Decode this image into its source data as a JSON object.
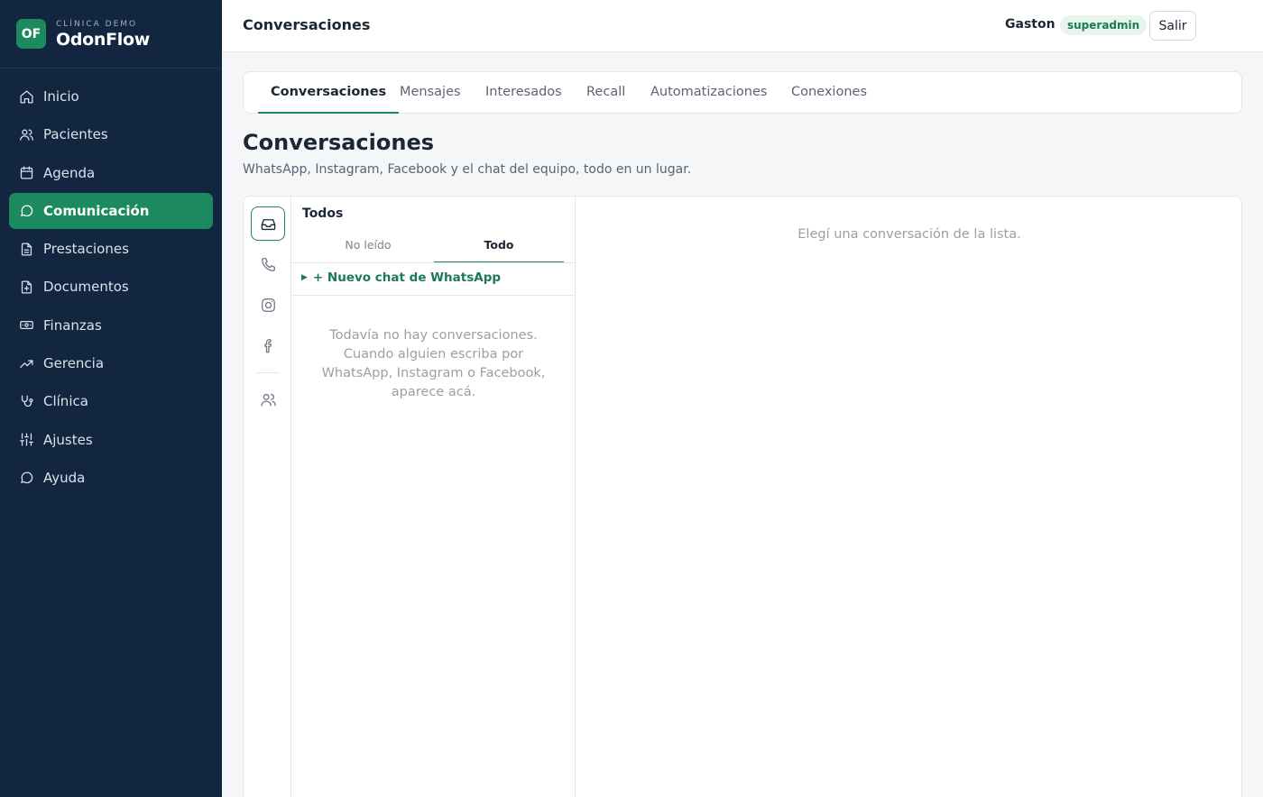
{
  "brand": {
    "logo_text": "OF",
    "subtitle": "CLÍNICA DEMO",
    "name": "OdonFlow"
  },
  "sidebar": {
    "items": [
      {
        "label": "Inicio",
        "icon": "home-icon",
        "active": false
      },
      {
        "label": "Pacientes",
        "icon": "users-icon",
        "active": false
      },
      {
        "label": "Agenda",
        "icon": "calendar-icon",
        "active": false
      },
      {
        "label": "Comunicación",
        "icon": "chat-bubble-icon",
        "active": true
      },
      {
        "label": "Prestaciones",
        "icon": "document-list-icon",
        "active": false
      },
      {
        "label": "Documentos",
        "icon": "document-plus-icon",
        "active": false
      },
      {
        "label": "Finanzas",
        "icon": "banknote-icon",
        "active": false
      },
      {
        "label": "Gerencia",
        "icon": "trending-up-icon",
        "active": false
      },
      {
        "label": "Clínica",
        "icon": "stethoscope-icon",
        "active": false
      },
      {
        "label": "Ajustes",
        "icon": "sliders-icon",
        "active": false
      },
      {
        "label": "Ayuda",
        "icon": "help-bubble-icon",
        "active": false
      }
    ]
  },
  "header": {
    "title": "Conversaciones",
    "user_name": "Gaston",
    "role": "superadmin",
    "logout_label": "Salir"
  },
  "tabs": [
    {
      "label": "Conversaciones",
      "active": true
    },
    {
      "label": "Mensajes",
      "active": false
    },
    {
      "label": "Interesados",
      "active": false
    },
    {
      "label": "Recall",
      "active": false
    },
    {
      "label": "Automatizaciones",
      "active": false
    },
    {
      "label": "Conexiones",
      "active": false
    }
  ],
  "page": {
    "heading": "Conversaciones",
    "subtitle": "WhatsApp, Instagram, Facebook y el chat del equipo, todo en un lugar."
  },
  "channels": [
    {
      "icon": "inbox-icon",
      "active": true
    },
    {
      "icon": "phone-icon",
      "active": false
    },
    {
      "icon": "instagram-icon",
      "active": false
    },
    {
      "icon": "facebook-icon",
      "active": false
    },
    {
      "icon": "team-icon",
      "active": false
    }
  ],
  "list": {
    "title": "Todos",
    "filter_unread": "No leído",
    "filter_all": "Todo",
    "new_chat": "+ Nuevo chat de WhatsApp",
    "empty": "Todavía no hay conversaciones. Cuando alguien escriba por WhatsApp, Instagram o Facebook, aparece acá."
  },
  "detail": {
    "empty": "Elegí una conversación de la lista."
  },
  "colors": {
    "sidebar_bg": "#132640",
    "accent": "#1c8a5e",
    "badge_bg": "#e7f5ee"
  }
}
